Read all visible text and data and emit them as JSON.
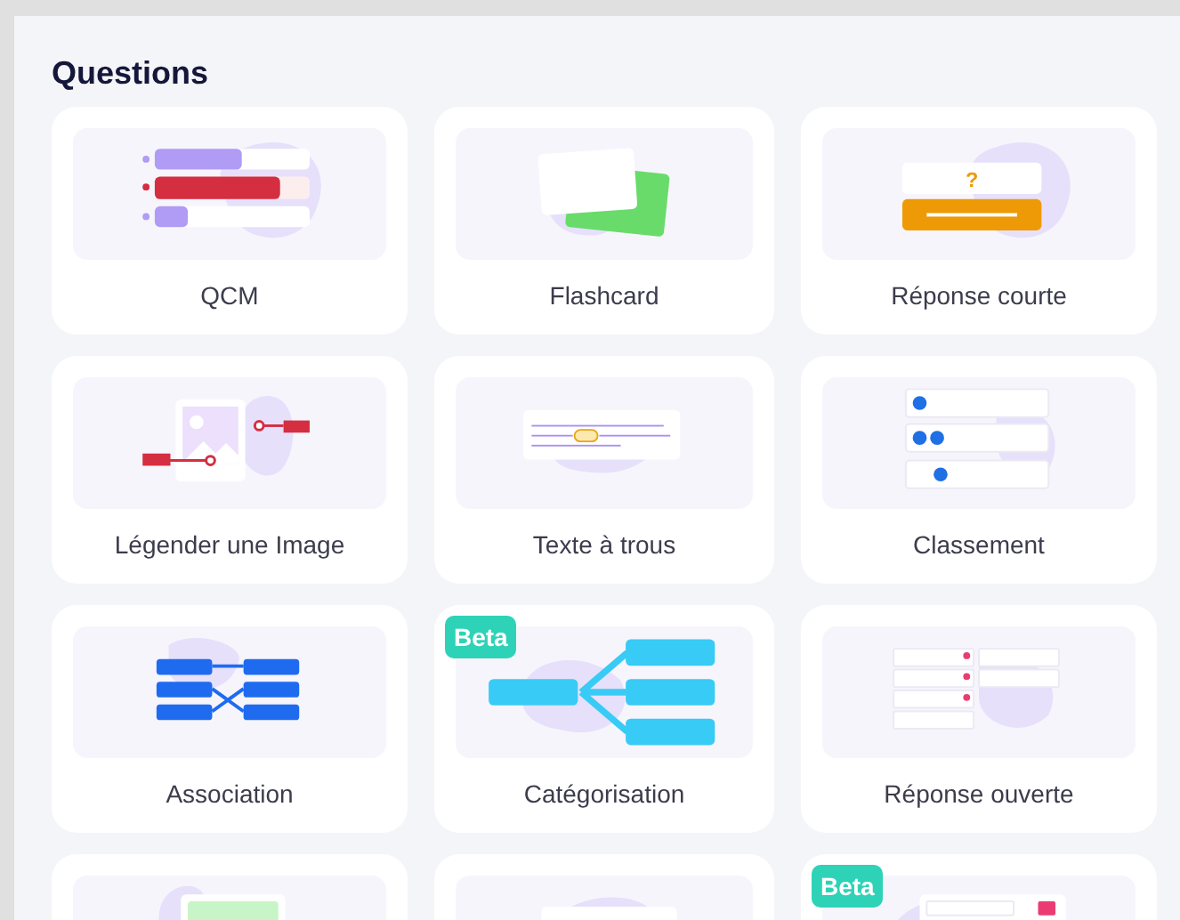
{
  "title": "Questions",
  "cards": [
    {
      "label": "QCM",
      "kind": "multiple-choice",
      "beta": false
    },
    {
      "label": "Flashcard",
      "kind": "flashcard",
      "beta": false
    },
    {
      "label": "Réponse courte",
      "kind": "short-answer",
      "beta": false,
      "glyph": "?"
    },
    {
      "label": "Légender une Image",
      "kind": "image-caption",
      "beta": false
    },
    {
      "label": "Texte à trous",
      "kind": "fill-blank",
      "beta": false
    },
    {
      "label": "Classement",
      "kind": "ranking",
      "beta": false
    },
    {
      "label": "Association",
      "kind": "matching",
      "beta": false
    },
    {
      "label": "Catégorisation",
      "kind": "categorize",
      "beta": true,
      "badge": "Beta"
    },
    {
      "label": "Réponse ouverte",
      "kind": "open-list",
      "beta": false
    },
    {
      "kind": "green-image",
      "beta": false
    },
    {
      "kind": "white-panel",
      "beta": false
    },
    {
      "kind": "pink-list",
      "beta": true,
      "badge": "Beta"
    }
  ]
}
